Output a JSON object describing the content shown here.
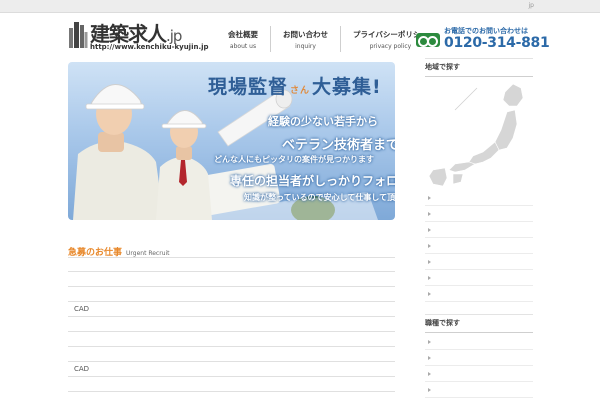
{
  "topbar": {
    "link": "jp"
  },
  "logo": {
    "title": "建築求人",
    "suffix": ".jp",
    "url": "http://www.kenchiku-kyujin.jp"
  },
  "nav": [
    {
      "jp": "会社概要",
      "en": "about us"
    },
    {
      "jp": "お問い合わせ",
      "en": "inquiry"
    },
    {
      "jp": "プライバシーポリシー",
      "en": "privacy policy"
    }
  ],
  "phone": {
    "label": "お電話でのお問い合わせは",
    "number": "0120-314-881",
    "icon": "free-dial-icon",
    "color": "#2c6aa8"
  },
  "hero": {
    "headline_main": "現場監督",
    "headline_san": "さん",
    "headline_end": "大募集!",
    "line1": "経験の少ない若手から",
    "line2": "ベテラン技術者まで",
    "line3": "どんな人にもピッタリの案件が見つかります",
    "line4": "専任の担当者がしっかりフォロー",
    "line5": "知識が整っているので安心して仕事して頂けます!"
  },
  "urgent": {
    "title_jp": "急募のお仕事",
    "title_en": "Urgent Recruit",
    "rows": [
      "",
      "",
      "",
      "CAD",
      "",
      "",
      "",
      "CAD",
      ""
    ]
  },
  "sidebar": {
    "region_title": "地域で探す",
    "region_rows": 8,
    "job_title": "職種で探す",
    "job_rows": 5
  },
  "colors": {
    "accent_orange": "#e8892c",
    "brand_blue": "#2c6aa8",
    "freedial_green": "#2c8a3e"
  }
}
